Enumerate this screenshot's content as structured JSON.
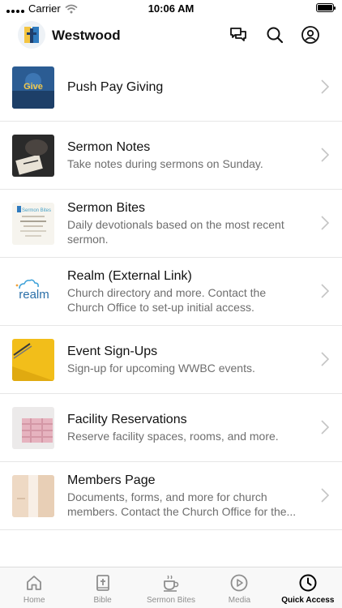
{
  "status_bar": {
    "carrier": "Carrier",
    "time": "10:06 AM"
  },
  "header": {
    "title": "Westwood"
  },
  "items": [
    {
      "title": "Push Pay Giving",
      "subtitle": "",
      "thumb_text": "Give"
    },
    {
      "title": "Sermon Notes",
      "subtitle": "Take notes during sermons on Sunday."
    },
    {
      "title": "Sermon Bites",
      "subtitle": "Daily devotionals based on the most recent sermon.",
      "thumb_text": "Sermon Bites"
    },
    {
      "title": "Realm (External Link)",
      "subtitle": "Church directory and more. Contact the Church Office to set-up initial access.",
      "thumb_text": "realm"
    },
    {
      "title": "Event Sign-Ups",
      "subtitle": "Sign-up for upcoming WWBC events."
    },
    {
      "title": "Facility Reservations",
      "subtitle": "Reserve facility spaces, rooms, and more."
    },
    {
      "title": "Members Page",
      "subtitle": "Documents, forms, and more for church members. Contact the Church Office for the..."
    }
  ],
  "tabs": [
    {
      "label": "Home",
      "icon": "home-icon"
    },
    {
      "label": "Bible",
      "icon": "bible-icon"
    },
    {
      "label": "Sermon Bites",
      "icon": "coffee-cup-icon"
    },
    {
      "label": "Media",
      "icon": "play-circle-icon"
    },
    {
      "label": "Quick Access",
      "icon": "clock-icon",
      "active": true
    }
  ],
  "colors": {
    "accent": "#000000",
    "inactive": "#8e8e8e",
    "divider": "#e6e6e6"
  }
}
